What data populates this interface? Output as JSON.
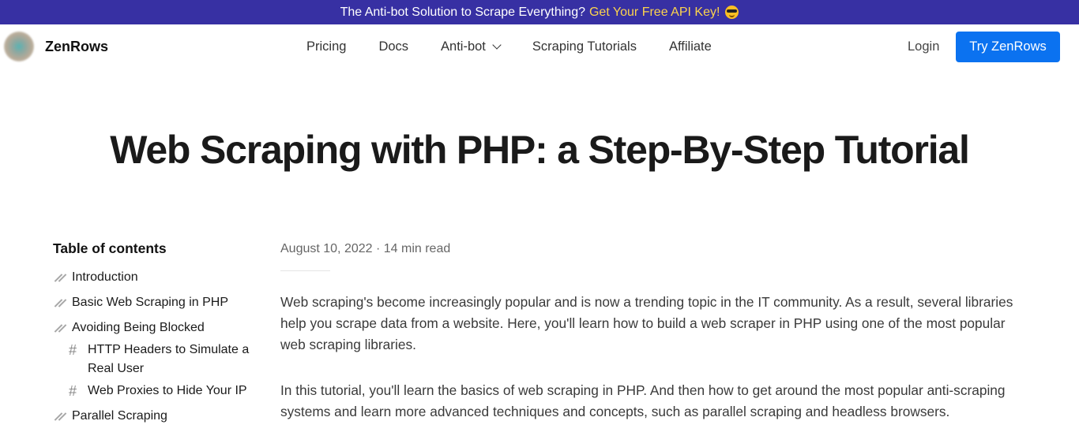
{
  "promo": {
    "text": "The Anti-bot Solution to Scrape Everything?",
    "cta": "Get Your Free API Key!",
    "emoji_icon": "sunglasses-emoji-icon",
    "cta_color": "#fcd34d",
    "background": "#3730a3"
  },
  "nav": {
    "brand": "ZenRows",
    "links": [
      {
        "label": "Pricing"
      },
      {
        "label": "Docs"
      },
      {
        "label": "Anti-bot",
        "has_dropdown": true
      },
      {
        "label": "Scraping Tutorials"
      },
      {
        "label": "Affiliate"
      }
    ],
    "login": "Login",
    "cta": "Try ZenRows",
    "cta_color": "#0b72f0"
  },
  "page": {
    "title": "Web Scraping with PHP: a Step-By-Step Tutorial"
  },
  "toc": {
    "title": "Table of contents",
    "items": [
      {
        "label": "Introduction",
        "level": 1,
        "icon": "double-slash-icon"
      },
      {
        "label": "Basic Web Scraping in PHP",
        "level": 1,
        "icon": "double-slash-icon"
      },
      {
        "label": "Avoiding Being Blocked",
        "level": 1,
        "icon": "double-slash-icon"
      },
      {
        "label": "HTTP Headers to Simulate a Real User",
        "level": 2,
        "icon": "hash-icon"
      },
      {
        "label": "Web Proxies to Hide Your IP",
        "level": 2,
        "icon": "hash-icon"
      },
      {
        "label": "Parallel Scraping",
        "level": 1,
        "icon": "double-slash-icon"
      }
    ]
  },
  "article": {
    "meta": "August 10, 2022 · 14 min read",
    "paragraphs": [
      "Web scraping's become increasingly popular and is now a trending topic in the IT community. As a result, several libraries help you scrape data from a website. Here, you'll learn how to build a web scraper in PHP using one of the most popular web scraping libraries.",
      "In this tutorial, you'll learn the basics of web scraping in PHP. And then how to get around the most popular anti-scraping systems and learn more advanced techniques and concepts, such as parallel scraping and headless browsers."
    ]
  }
}
